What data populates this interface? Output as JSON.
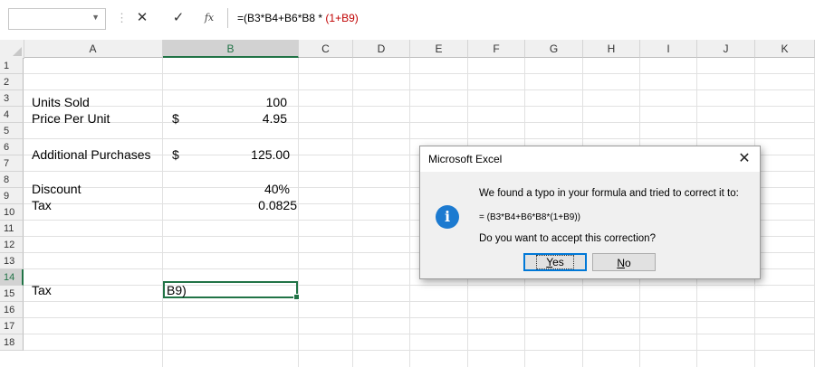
{
  "formula_bar": {
    "namebox_value": "",
    "cancel_glyph": "✕",
    "enter_glyph": "✓",
    "fx_label": "fx",
    "formula_prefix": "=(B3*B4+B6*B8 * ",
    "formula_suffix": "(1+B9)"
  },
  "columns": [
    "A",
    "B",
    "C",
    "D",
    "E",
    "F",
    "G",
    "H",
    "I",
    "J",
    "K"
  ],
  "rows": [
    "1",
    "2",
    "3",
    "4",
    "5",
    "6",
    "7",
    "8",
    "9",
    "10",
    "11",
    "12",
    "13",
    "14",
    "15",
    "16",
    "17",
    "18"
  ],
  "cells": {
    "a3": "Units Sold",
    "b3": "100",
    "a4": "Price Per Unit",
    "b4_currency": "$",
    "b4": "4.95",
    "a6": "Additional Purchases",
    "b6_currency": "$",
    "b6": "125.00",
    "a8": "Discount",
    "b8": "40%",
    "a9": "Tax",
    "b9": "0.0825",
    "a14": "Tax",
    "b14": "B9)"
  },
  "dialog": {
    "title": "Microsoft Excel",
    "message": "We found a typo in your formula and tried to correct it to:",
    "corrected_formula": "= (B3*B4+B6*B8*(1+B9))",
    "question": "Do you want to accept this correction?",
    "yes_first": "Y",
    "yes_rest": "es",
    "no_first": "N",
    "no_rest": "o",
    "info_glyph": "i",
    "close_glyph": "✕"
  },
  "colors": {
    "selection": "#217346",
    "formula_error": "#c00000",
    "info_icon": "#1c7ad0"
  }
}
